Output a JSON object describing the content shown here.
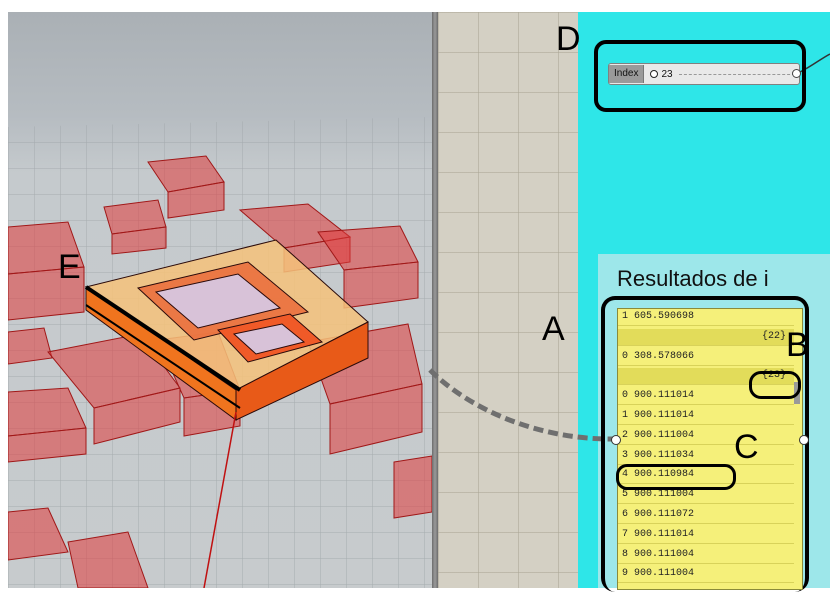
{
  "annotations": {
    "a": "A",
    "b": "B",
    "c": "C",
    "d": "D",
    "e": "E"
  },
  "slider": {
    "label": "Index",
    "value": "23"
  },
  "results": {
    "title": "Resultados de i",
    "rows": [
      {
        "index": "1",
        "value": "605.590698",
        "is_path": false
      },
      {
        "index": "",
        "value": "{22}",
        "is_path": true
      },
      {
        "index": "0",
        "value": "308.578066",
        "is_path": false
      },
      {
        "index": "",
        "value": "{23}",
        "is_path": true
      },
      {
        "index": "0",
        "value": "900.111014",
        "is_path": false
      },
      {
        "index": "1",
        "value": "900.111014",
        "is_path": false
      },
      {
        "index": "2",
        "value": "900.111004",
        "is_path": false
      },
      {
        "index": "3",
        "value": "900.111034",
        "is_path": false
      },
      {
        "index": "4",
        "value": "900.110984",
        "is_path": false
      },
      {
        "index": "5",
        "value": "900.111004",
        "is_path": false
      },
      {
        "index": "6",
        "value": "900.111072",
        "is_path": false
      },
      {
        "index": "7",
        "value": "900.111014",
        "is_path": false
      },
      {
        "index": "8",
        "value": "900.111004",
        "is_path": false
      },
      {
        "index": "9",
        "value": "900.111004",
        "is_path": false
      }
    ]
  },
  "colors": {
    "group_background": "#2ee6e8",
    "panel_background": "#f5f07a",
    "building_context": "#e03a3a",
    "building_selected": "#f07a2a"
  }
}
